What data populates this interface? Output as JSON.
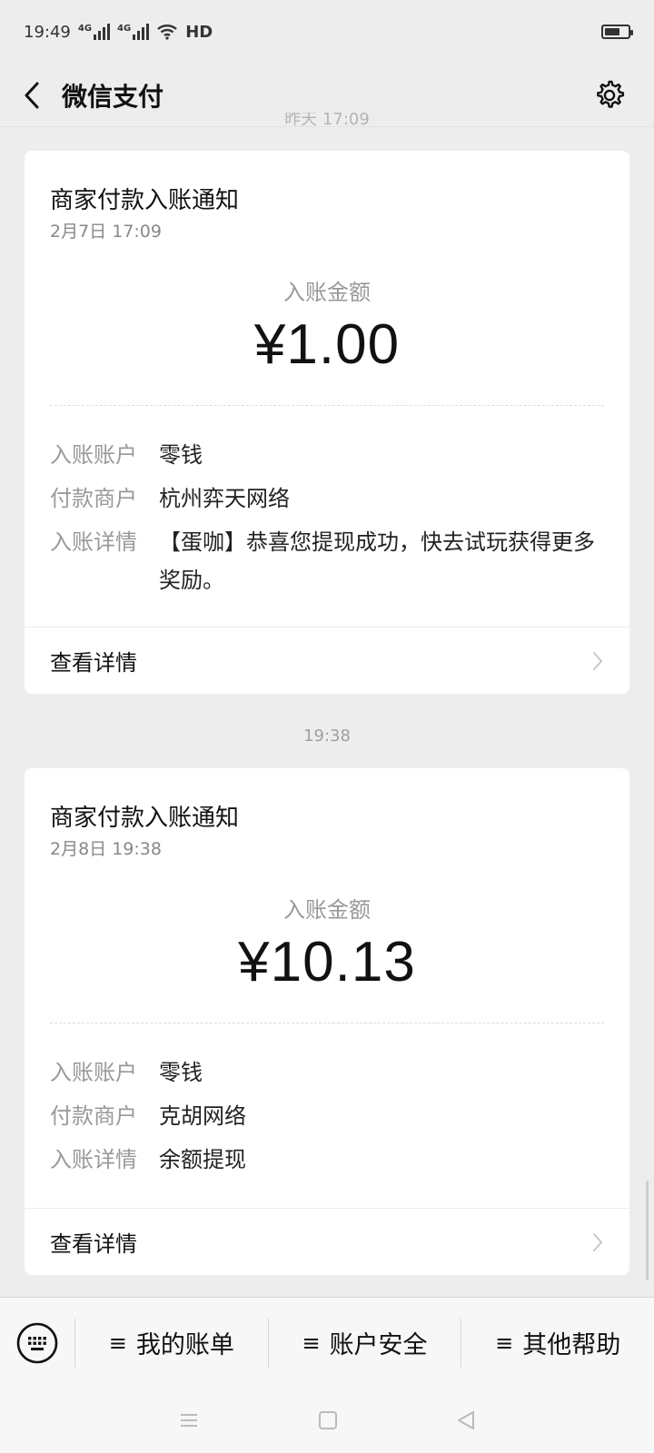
{
  "status_bar": {
    "time": "19:49",
    "signal_1": "4G",
    "signal_2": "4G",
    "hd": "HD",
    "icons": [
      "signal-icon",
      "wifi-icon",
      "battery-icon"
    ],
    "battery_level": 0.65
  },
  "header": {
    "title": "微信支付",
    "icons": [
      "back-chevron-icon",
      "gear-icon"
    ]
  },
  "peek_time": "昨天 17:09",
  "messages": [
    {
      "title": "商家付款入账通知",
      "date": "2月7日  17:09",
      "amount_label": "入账金额",
      "amount": "¥1.00",
      "rows": [
        {
          "label": "入账账户",
          "value": "零钱"
        },
        {
          "label": "付款商户",
          "value": "杭州弈天网络"
        },
        {
          "label": "入账详情",
          "value": "【蛋咖】恭喜您提现成功，快去试玩获得更多奖励。"
        }
      ],
      "footer": "查看详情"
    },
    {
      "time_divider": "19:38",
      "title": "商家付款入账通知",
      "date": "2月8日  19:38",
      "amount_label": "入账金额",
      "amount": "¥10.13",
      "rows": [
        {
          "label": "入账账户",
          "value": "零钱"
        },
        {
          "label": "付款商户",
          "value": "克胡网络"
        },
        {
          "label": "入账详情",
          "value": "余额提现"
        }
      ],
      "footer": "查看详情"
    }
  ],
  "bottom_menu": {
    "keyboard_icon": "keyboard-icon",
    "items": [
      {
        "icon": "≡",
        "label": "我的账单"
      },
      {
        "icon": "≡",
        "label": "账户安全"
      },
      {
        "icon": "≡",
        "label": "其他帮助"
      }
    ]
  },
  "system_nav": [
    "menu-icon",
    "home-icon",
    "back-icon"
  ],
  "colors": {
    "page_bg": "#ededed",
    "card_bg": "#ffffff",
    "muted": "#999999"
  }
}
